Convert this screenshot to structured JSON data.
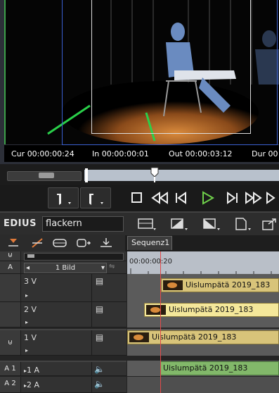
{
  "preview": {
    "timecodes": [
      {
        "label": "Cur",
        "value": "00:00:00:24"
      },
      {
        "label": "In",
        "value": "00:00:00:01"
      },
      {
        "label": "Out",
        "value": "00:00:03:12"
      },
      {
        "label": "Dur",
        "value": "00"
      }
    ]
  },
  "app": {
    "logo": "EDIUS",
    "project_name": "flackern"
  },
  "timeline": {
    "sequence_tab": "Sequenz1",
    "ruler_timecode": "00:00:00:20",
    "zoom_label": "1 Bild",
    "tracks": [
      {
        "lock": "",
        "name": "3 V"
      },
      {
        "lock": "",
        "name": "2 V"
      },
      {
        "lock": "",
        "name": "1 V"
      },
      {
        "lock": "A 1",
        "name": "1 A"
      },
      {
        "lock": "A 2",
        "name": "2 A"
      }
    ],
    "clips": {
      "v3": "Uislumpätä 2019_183",
      "v2": "Uislumpätä 2019_183",
      "v1": "Uislumpätä 2019_183",
      "a1": "Uislumpätä 2019_183"
    }
  },
  "colors": {
    "clip_video": "#d8c47a",
    "clip_audio": "#82b86a",
    "play_button": "#6fcf4a",
    "ruler": "#b9bfc8"
  }
}
